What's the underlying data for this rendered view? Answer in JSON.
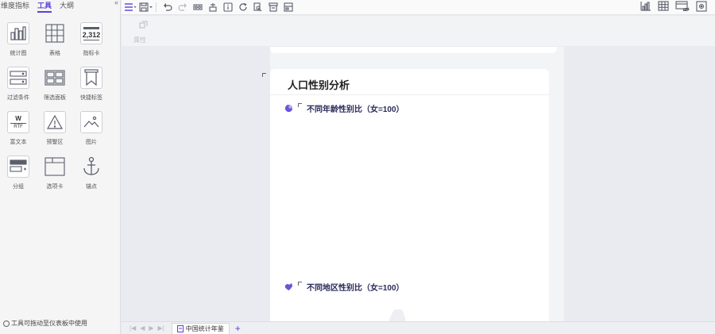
{
  "left_panel": {
    "tabs": [
      {
        "label": "维度指标",
        "active": false
      },
      {
        "label": "工具",
        "active": true
      },
      {
        "label": "大纲",
        "active": false
      }
    ],
    "collapse_icon": "double-chevron-icon",
    "tools": [
      {
        "label": "统计图",
        "icon": "chart-icon"
      },
      {
        "label": "表格",
        "icon": "table-icon"
      },
      {
        "label": "指标卡",
        "icon": "kpi-card-icon",
        "icon_text": "2,312"
      },
      {
        "label": "过滤条件",
        "icon": "filter-condition-icon"
      },
      {
        "label": "筛选面板",
        "icon": "filter-panel-icon"
      },
      {
        "label": "快捷标签",
        "icon": "bookmark-icon"
      },
      {
        "label": "富文本",
        "icon": "rich-text-icon",
        "icon_text_top": "W",
        "icon_text_bottom": "RTF"
      },
      {
        "label": "预警区",
        "icon": "warning-icon"
      },
      {
        "label": "图片",
        "icon": "image-icon"
      },
      {
        "label": "分组",
        "icon": "group-icon"
      },
      {
        "label": "选项卡",
        "icon": "tab-card-icon"
      },
      {
        "label": "锚点",
        "icon": "anchor-icon"
      }
    ],
    "footer_text": "工具可拖动至仪表板中使用"
  },
  "toolbar": {
    "left_icons": [
      "menu-icon",
      "save-icon",
      "undo-icon",
      "redo-icon",
      "copy-format-icon",
      "clear-icon",
      "info-icon",
      "refresh-icon",
      "export-icon",
      "data-icon",
      "settings-page-icon"
    ],
    "right_icons": [
      "chart-view-icon",
      "grid-view-icon",
      "hide-icon",
      "gear-icon"
    ]
  },
  "subbar": {
    "label": "属性"
  },
  "canvas": {
    "card_title": "人口性别分析",
    "sections": [
      {
        "title": "不同年龄性别比（女=100）",
        "icon": "pie-chart-icon"
      },
      {
        "title": "不同地区性别比（女=100）",
        "icon": "map-icon"
      }
    ]
  },
  "bottombar": {
    "sheet_name": "中国统计年鉴",
    "add_label": "+"
  },
  "colors": {
    "accent": "#5a3fd6",
    "panel_bg": "#f5f5f6",
    "canvas_bg": "#e9ebf0"
  }
}
